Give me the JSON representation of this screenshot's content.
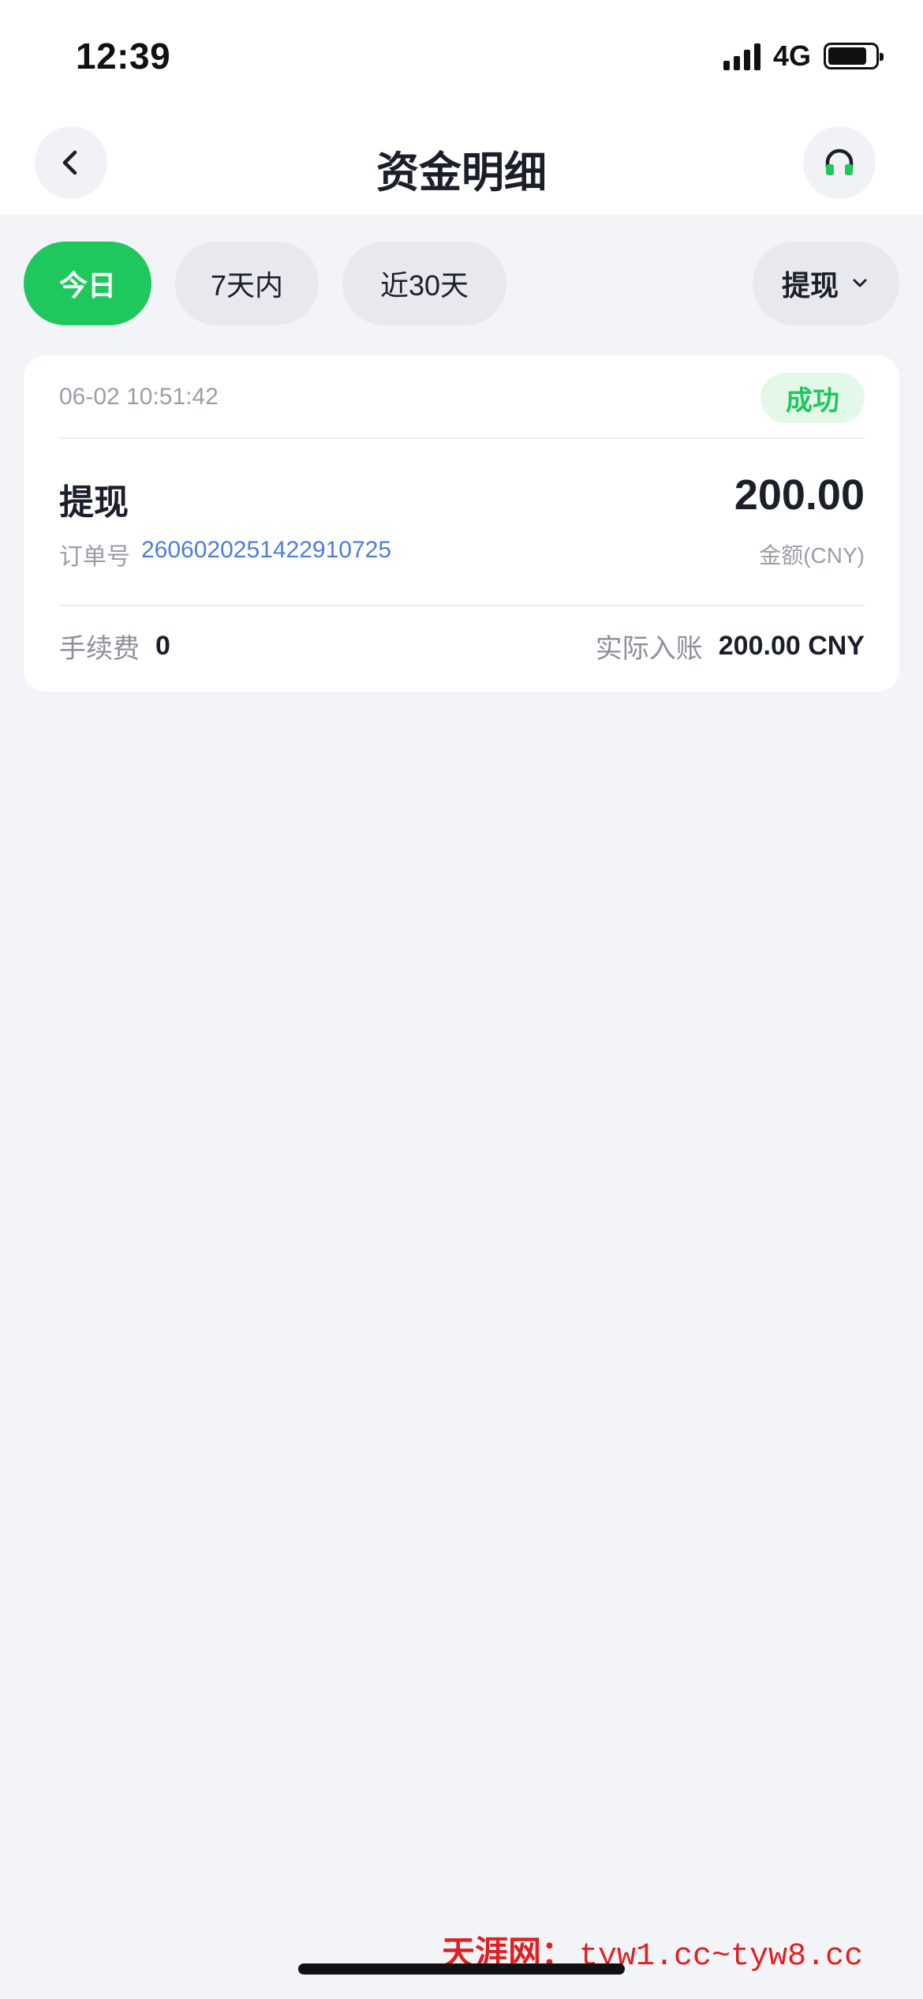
{
  "status_bar": {
    "time": "12:39",
    "network": "4G",
    "battery_fraction": 0.82
  },
  "header": {
    "title": "资金明细",
    "back_icon": "chevron-left-icon",
    "support_icon": "headphones-icon"
  },
  "filters": {
    "ranges": [
      "今日",
      "7天内",
      "近30天"
    ],
    "active_index": 0,
    "type_selected": "提现",
    "type_icon": "chevron-down-icon"
  },
  "transaction": {
    "datetime": "06-02 10:51:42",
    "status": "成功",
    "type": "提现",
    "amount": "200.00",
    "order_label": "订单号",
    "order_number": "2606020251422910725",
    "amount_unit_label": "金额(CNY)",
    "fee_label": "手续费",
    "fee_value": "0",
    "actual_label": "实际入账",
    "actual_value": "200.00 CNY"
  },
  "watermark": {
    "site": "天涯网：",
    "urls": "tyw1.cc~tyw8.cc"
  },
  "colors": {
    "accent_green": "#1ec85c",
    "link_blue": "#4c7de0",
    "background": "#f3f4f8",
    "watermark_red": "#e02020"
  }
}
